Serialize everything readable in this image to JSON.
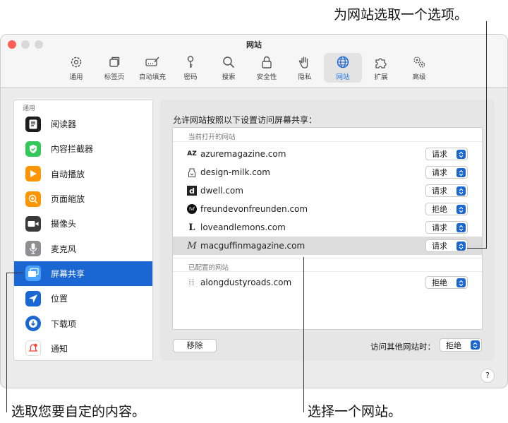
{
  "callouts": {
    "top_right": "为网站选取一个选项。",
    "bottom_left": "选取您要自定的内容。",
    "bottom_right": "选择一个网站。"
  },
  "window": {
    "title": "网站"
  },
  "toolbar": [
    {
      "label": "通用",
      "icon": "gear-icon"
    },
    {
      "label": "标签页",
      "icon": "tabs-icon"
    },
    {
      "label": "自动填充",
      "icon": "autofill-icon"
    },
    {
      "label": "密码",
      "icon": "key-icon"
    },
    {
      "label": "搜索",
      "icon": "search-icon"
    },
    {
      "label": "安全性",
      "icon": "lock-icon"
    },
    {
      "label": "隐私",
      "icon": "hand-icon"
    },
    {
      "label": "网站",
      "icon": "globe-icon",
      "active": true
    },
    {
      "label": "扩展",
      "icon": "puzzle-icon"
    },
    {
      "label": "高级",
      "icon": "gears-icon"
    }
  ],
  "sidebar": {
    "header": "通用",
    "items": [
      {
        "label": "阅读器",
        "icon": "reader-icon",
        "color": "#1c1c1e"
      },
      {
        "label": "内容拦截器",
        "icon": "content-blocker-icon",
        "color": "#34c759"
      },
      {
        "label": "自动播放",
        "icon": "autoplay-icon",
        "color": "#ff9500"
      },
      {
        "label": "页面缩放",
        "icon": "page-zoom-icon",
        "color": "#ff9500"
      },
      {
        "label": "摄像头",
        "icon": "camera-icon",
        "color": "#3a3a3c"
      },
      {
        "label": "麦克风",
        "icon": "microphone-icon",
        "color": "#8e8e93"
      },
      {
        "label": "屏幕共享",
        "icon": "screen-sharing-icon",
        "color": "#1a66d2",
        "selected": true
      },
      {
        "label": "位置",
        "icon": "location-icon",
        "color": "#1a66d2"
      },
      {
        "label": "下载项",
        "icon": "downloads-icon",
        "color": "#1a66d2"
      },
      {
        "label": "通知",
        "icon": "notifications-icon",
        "color": "#ff3b30"
      }
    ]
  },
  "content": {
    "heading": "允许网站按照以下设置访问屏幕共享：",
    "section_open": "当前打开的网站",
    "section_configured": "已配置的网站",
    "open_sites": [
      {
        "domain": "azuremagazine.com",
        "favicon": "AZ",
        "value": "请求"
      },
      {
        "domain": "design-milk.com",
        "favicon": "design-milk-icon",
        "value": "请求"
      },
      {
        "domain": "dwell.com",
        "favicon": "d",
        "value": "请求"
      },
      {
        "domain": "freundevonfreunden.com",
        "favicon": "fvf",
        "value": "拒绝"
      },
      {
        "domain": "loveandlemons.com",
        "favicon": "L",
        "value": "请求"
      },
      {
        "domain": "macguffinmagazine.com",
        "favicon": "M",
        "value": "请求",
        "selected": true
      }
    ],
    "configured_sites": [
      {
        "domain": "alongdustyroads.com",
        "favicon": "alongdustyroads-icon",
        "value": "拒绝"
      }
    ],
    "remove_button": "移除",
    "other_sites_label": "访问其他网站时：",
    "other_sites_value": "拒绝"
  },
  "help_button": "?"
}
